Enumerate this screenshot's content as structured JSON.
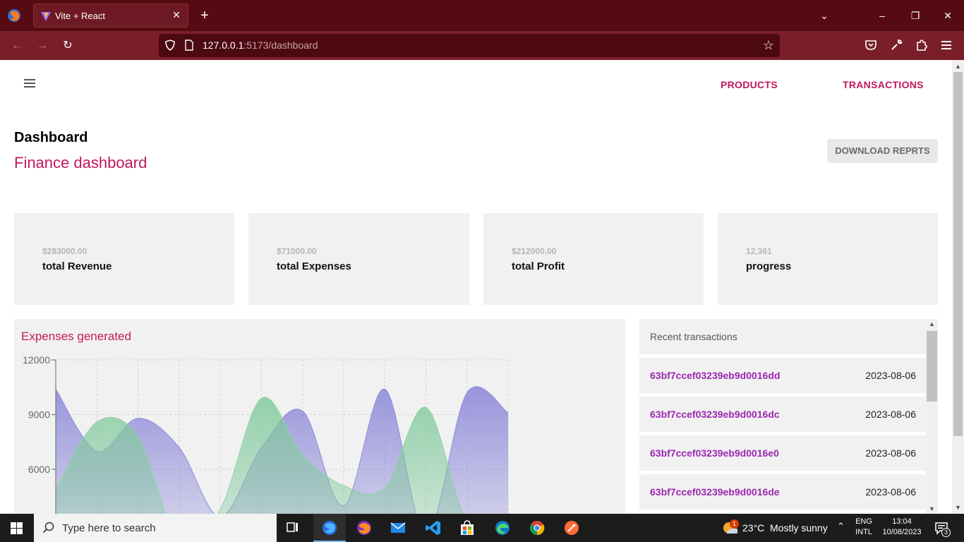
{
  "browser": {
    "tab_title": "Vite + React",
    "url_host": "127.0.0.1",
    "url_path": ":5173/dashboard"
  },
  "header": {
    "nav_links": [
      "PRODUCTS",
      "TRANSACTIONS"
    ]
  },
  "page": {
    "title": "Dashboard",
    "subtitle": "Finance dashboard",
    "download_label": "DOWNLOAD REPRTS"
  },
  "stats": [
    {
      "value": "$283000.00",
      "label": "total Revenue"
    },
    {
      "value": "$71000.00",
      "label": "total Expenses"
    },
    {
      "value": "$212000.00",
      "label": "total Profit"
    },
    {
      "value": "12,361",
      "label": "progress"
    }
  ],
  "expenses_chart": {
    "title": "Expenses generated"
  },
  "chart_data": {
    "type": "area",
    "title": "Expenses generated",
    "ylim": [
      0,
      12000
    ],
    "yticks": [
      "12000",
      "9000",
      "6000"
    ],
    "x": [
      0,
      1,
      2,
      3,
      4,
      5,
      6,
      7,
      8,
      9,
      10,
      11
    ],
    "series": [
      {
        "color": "#8f8bdc",
        "values": [
          10400,
          7000,
          8800,
          7200,
          3400,
          7200,
          9200,
          4000,
          10400,
          2400,
          10200,
          9100
        ]
      },
      {
        "color": "#8fd4a8",
        "values": [
          4900,
          8600,
          7800,
          2000,
          3800,
          9900,
          6800,
          5100,
          5000,
          9400,
          3200,
          3400
        ]
      }
    ],
    "grid": true
  },
  "transactions": {
    "header": "Recent transactions",
    "rows": [
      {
        "id": "63bf7ccef03239eb9d0016dd",
        "date": "2023-08-06"
      },
      {
        "id": "63bf7ccef03239eb9d0016dc",
        "date": "2023-08-06"
      },
      {
        "id": "63bf7ccef03239eb9d0016e0",
        "date": "2023-08-06"
      },
      {
        "id": "63bf7ccef03239eb9d0016de",
        "date": "2023-08-06"
      }
    ]
  },
  "taskbar": {
    "search_placeholder": "Type here to search",
    "weather_temp": "23°C",
    "weather_desc": "Mostly sunny",
    "weather_badge": "1",
    "lang_top": "ENG",
    "lang_bottom": "INTL",
    "time": "13:04",
    "date": "10/08/2023",
    "notification_count": "3"
  }
}
